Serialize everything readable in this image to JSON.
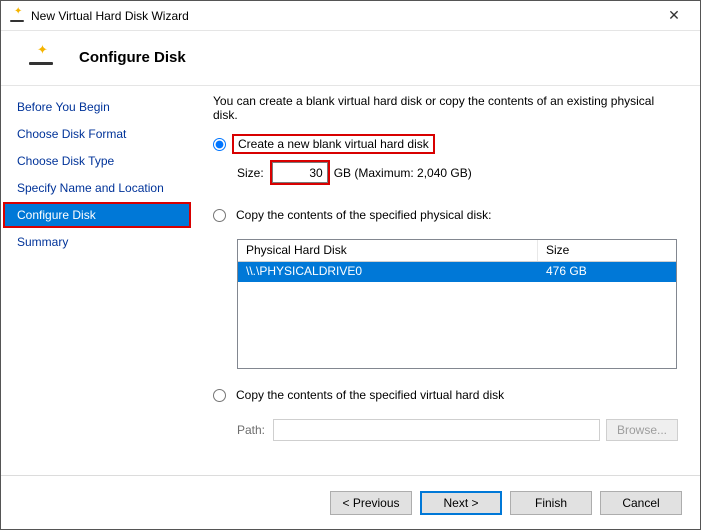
{
  "window": {
    "title": "New Virtual Hard Disk Wizard"
  },
  "header": {
    "title": "Configure Disk"
  },
  "sidebar": {
    "items": [
      {
        "label": "Before You Begin"
      },
      {
        "label": "Choose Disk Format"
      },
      {
        "label": "Choose Disk Type"
      },
      {
        "label": "Specify Name and Location"
      },
      {
        "label": "Configure Disk"
      },
      {
        "label": "Summary"
      }
    ],
    "active_index": 4
  },
  "main": {
    "intro": "You can create a blank virtual hard disk or copy the contents of an existing physical disk.",
    "opt_blank": {
      "label": "Create a new blank virtual hard disk"
    },
    "size": {
      "label": "Size:",
      "value": "30",
      "unit_text": "GB (Maximum: 2,040 GB)"
    },
    "opt_phys": {
      "label": "Copy the contents of the specified physical disk:"
    },
    "table": {
      "col_disk": "Physical Hard Disk",
      "col_size": "Size",
      "rows": [
        {
          "disk": "\\\\.\\PHYSICALDRIVE0",
          "size": "476 GB"
        }
      ]
    },
    "opt_vhd": {
      "label": "Copy the contents of the specified virtual hard disk"
    },
    "path": {
      "label": "Path:",
      "value": "",
      "browse": "Browse..."
    }
  },
  "footer": {
    "previous": "< Previous",
    "next": "Next >",
    "finish": "Finish",
    "cancel": "Cancel"
  }
}
